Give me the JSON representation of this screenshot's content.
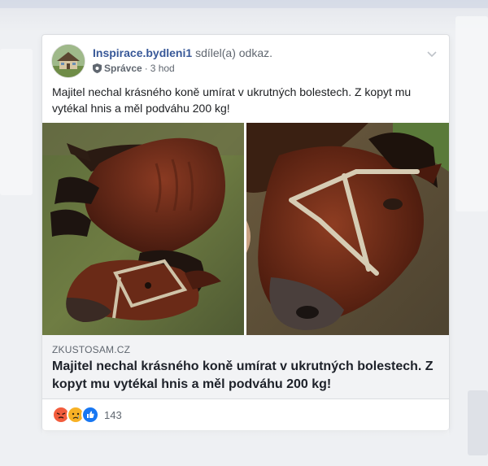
{
  "post": {
    "author": "Inspirace.bydleni1",
    "action": "sdílel(a) odkaz.",
    "role": "Správce",
    "time": "3 hod",
    "text": "Majitel nechal krásného koně umírat v ukrutných bolestech. Z kopyt mu vytékal hnis a měl podváhu 200 kg!"
  },
  "link": {
    "domain": "ZKUSTOSAM.CZ",
    "title": "Majitel nechal krásného koně umírat v ukrutných bolestech. Z kopyt mu vytékal hnis a měl podváhu 200 kg!"
  },
  "reactions": {
    "icons": [
      "angry-icon",
      "sad-icon",
      "like-icon"
    ],
    "count": "143"
  },
  "colors": {
    "author_link": "#385898",
    "text": "#1c1e21",
    "muted": "#606770",
    "link_box_bg": "#f2f3f5",
    "like_blue": "#1877f2",
    "angry_orange": "#f25c3d",
    "sad_yellow": "#f7b125"
  }
}
